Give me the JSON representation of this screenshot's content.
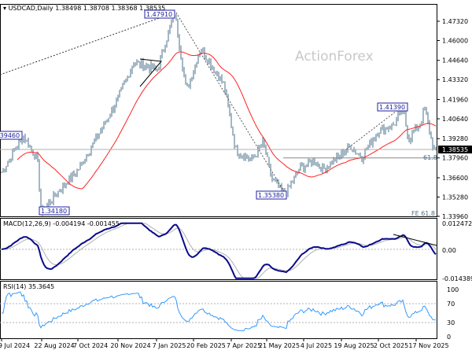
{
  "chart_data": [
    {
      "type": "ohlc",
      "title": "USDCAD,Daily",
      "symbol": "USDCAD",
      "timeframe": "Daily",
      "ohlc_last": {
        "open": "1.38498",
        "high": "1.38708",
        "low": "1.38368",
        "close": "1.38535"
      },
      "header_text": "USDCAD,Daily  1.38498 1.38708 1.38368 1.38535",
      "current_price_label": "1.38535",
      "ylim": [
        1.3325,
        1.4856
      ],
      "y_ticks": [
        "1.47320",
        "1.46000",
        "1.44640",
        "1.43320",
        "1.41960",
        "1.40640",
        "1.39280",
        "1.37960",
        "1.36600",
        "1.35280",
        "1.33960"
      ],
      "x_ticks": [
        "9 Jul 2024",
        "22 Aug 2024",
        "7 Oct 2024",
        "20 Nov 2024",
        "7 Jan 2025",
        "20 Feb 2025",
        "7 Apr 2025",
        "21 May 2025",
        "4 Jul 2025",
        "19 Aug 2025",
        "2 Oct 2025",
        "17 Nov 2025"
      ],
      "price_path": [
        [
          "2024-06-22",
          1.368
        ],
        [
          "2024-07-20",
          1.3946
        ],
        [
          "2024-08-06",
          1.378
        ],
        [
          "2024-08-10",
          1.3418
        ],
        [
          "2024-09-05",
          1.36
        ],
        [
          "2024-09-24",
          1.372
        ],
        [
          "2024-10-22",
          1.4
        ],
        [
          "2024-11-10",
          1.42
        ],
        [
          "2024-11-29",
          1.445
        ],
        [
          "2024-12-27",
          1.44
        ],
        [
          "2025-01-17",
          1.4791
        ],
        [
          "2025-01-31",
          1.425
        ],
        [
          "2025-02-17",
          1.455
        ],
        [
          "2025-03-17",
          1.43
        ],
        [
          "2025-03-31",
          1.385
        ],
        [
          "2025-04-19",
          1.378
        ],
        [
          "2025-05-03",
          1.39
        ],
        [
          "2025-05-13",
          1.365
        ],
        [
          "2025-05-29",
          1.3538
        ],
        [
          "2025-06-15",
          1.372
        ],
        [
          "2025-07-03",
          1.378
        ],
        [
          "2025-07-13",
          1.372
        ],
        [
          "2025-08-01",
          1.38
        ],
        [
          "2025-08-15",
          1.388
        ],
        [
          "2025-08-29",
          1.38
        ],
        [
          "2025-09-17",
          1.398
        ],
        [
          "2025-10-06",
          1.402
        ],
        [
          "2025-10-17",
          1.4139
        ],
        [
          "2025-10-24",
          1.392
        ],
        [
          "2025-11-08",
          1.405
        ],
        [
          "2025-11-12",
          1.413
        ],
        [
          "2025-11-19",
          1.395
        ],
        [
          "2025-11-24",
          1.383
        ],
        [
          "2025-11-27",
          1.38535
        ]
      ],
      "annotations": {
        "high_label": "1.47910",
        "swing_high_label": "1.41390",
        "swing_low_label": "1.35380",
        "low_label": "1.34180",
        "left_label": "1.39460",
        "fib_label": "61.8",
        "fib_level": 1.3796,
        "fe_label": "FE 61.8"
      },
      "watermark": "ActionForex",
      "colors": {
        "bars": "#4a6f8a",
        "ma": "#ff2020",
        "axis": "#000000",
        "grid": "#c0c0c0"
      }
    },
    {
      "type": "line",
      "title": "MACD(12,26,9) -0.004194 -0.001455",
      "ylim": [
        -0.014389,
        0.012472
      ],
      "y_ticks": [
        "0.012472",
        "0.00",
        "-0.014389"
      ],
      "colors": {
        "macd": "#0a0a8a",
        "signal": "#b0b0b0"
      }
    },
    {
      "type": "line",
      "title": "RSI(14) 35.3645",
      "ylim": [
        0,
        100
      ],
      "y_ticks": [
        "100",
        "70",
        "30",
        "0"
      ],
      "levels": [
        70,
        30
      ],
      "colors": {
        "rsi": "#3399ff"
      }
    }
  ]
}
